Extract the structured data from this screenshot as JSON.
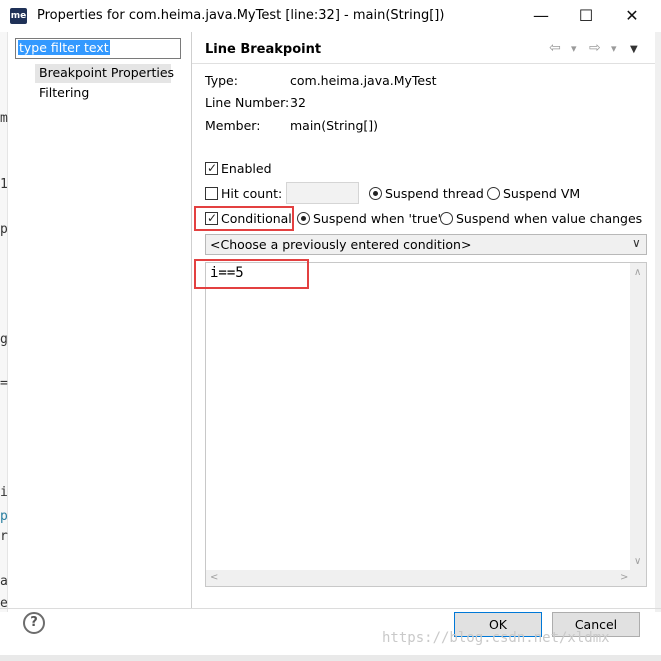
{
  "window": {
    "icon_label": "me",
    "title": "Properties for com.heima.java.MyTest [line:32] - main(String[])",
    "minimize": "—",
    "maximize": "☐",
    "close": "✕"
  },
  "sidebar": {
    "filter_value": "type filter text",
    "items": [
      {
        "label": "Breakpoint Properties",
        "selected": true
      },
      {
        "label": "Filtering",
        "selected": false
      }
    ]
  },
  "background_editor": [
    "m",
    "1",
    "p",
    "g",
    "=",
    "i",
    "p",
    "r",
    "a",
    "e"
  ],
  "panel": {
    "title": "Line Breakpoint",
    "nav": {
      "back": "⇦",
      "back_menu": "▾",
      "forward": "⇨",
      "forward_menu": "▾",
      "view_menu": "▼"
    },
    "type_label": "Type:",
    "type_value": "com.heima.java.MyTest",
    "line_label": "Line Number:",
    "line_value": "32",
    "member_label": "Member:",
    "member_value": "main(String[])"
  },
  "options": {
    "enabled_label": "Enabled",
    "enabled_checked": true,
    "hitcount_label": "Hit count:",
    "hitcount_checked": false,
    "hitcount_value": "",
    "suspend_thread_label": "Suspend thread",
    "suspend_thread_selected": true,
    "suspend_vm_label": "Suspend VM",
    "suspend_vm_selected": false,
    "conditional_label": "Conditional",
    "conditional_checked": true,
    "suspend_true_label": "Suspend when 'true'",
    "suspend_true_selected": true,
    "suspend_changes_label": "Suspend when value changes",
    "suspend_changes_selected": false
  },
  "condition": {
    "combo_text": "<Choose a previously entered condition>",
    "expression": "i==5"
  },
  "footer": {
    "help": "?",
    "ok_label": "OK",
    "cancel_label": "Cancel",
    "watermark": "https://blog.csdn.net/xldmx"
  },
  "colors": {
    "highlight_red": "#e34040",
    "selection_blue": "#3399ff",
    "default_button_border": "#0078d7"
  }
}
